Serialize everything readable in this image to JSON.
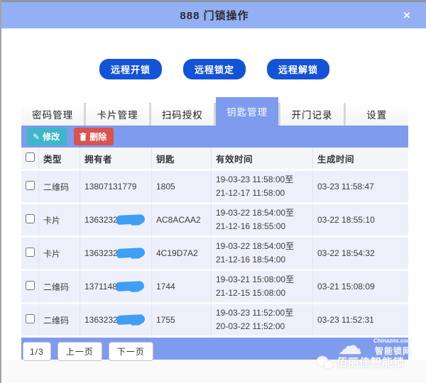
{
  "dialog": {
    "title": "888 门锁操作",
    "close_glyph": "×"
  },
  "actions": {
    "unlock_label": "远程开锁",
    "lock_label": "远程锁定",
    "release_label": "远程解锁"
  },
  "tabs": [
    {
      "label": "密码管理",
      "active": false
    },
    {
      "label": "卡片管理",
      "active": false
    },
    {
      "label": "扫码授权",
      "active": false
    },
    {
      "label": "钥匙管理",
      "active": true
    },
    {
      "label": "开门记录",
      "active": false
    },
    {
      "label": "设置",
      "active": false
    }
  ],
  "toolbar": {
    "modify_label": "修改",
    "modify_icon": "pencil-icon",
    "modify_glyph": "✎",
    "delete_label": "删除",
    "delete_icon": "trash-icon"
  },
  "table": {
    "columns": [
      "类型",
      "拥有者",
      "钥匙",
      "有效时间",
      "生成时间"
    ],
    "rows": [
      {
        "type": "二维码",
        "owner": "13807131779",
        "owner_redacted": false,
        "key": "1805",
        "valid_1": "19-03-23 11:58:00至",
        "valid_2": "21-12-17 11:58:00",
        "created": "03-23 11:58:47"
      },
      {
        "type": "卡片",
        "owner": "1363232",
        "owner_redacted": true,
        "key": "AC8ACAA2",
        "valid_1": "19-03-22 18:54:00至",
        "valid_2": "21-12-16 18:55:00",
        "created": "03-22 18:55:10"
      },
      {
        "type": "卡片",
        "owner": "1363232",
        "owner_redacted": true,
        "key": "4C19D7A2",
        "valid_1": "19-03-22 18:54:00至",
        "valid_2": "21-12-16 18:54:00",
        "created": "03-22 18:54:32"
      },
      {
        "type": "二维码",
        "owner": "1371148",
        "owner_redacted": true,
        "key": "1744",
        "valid_1": "19-03-21 15:08:00至",
        "valid_2": "21-12-15 15:08:00",
        "created": "03-21 15:08:09"
      },
      {
        "type": "二维码",
        "owner": "1363232",
        "owner_redacted": true,
        "key": "1755",
        "valid_1": "19-03-23 11:52:00至",
        "valid_2": "20-03-22 11:52:00",
        "created": "03-23 11:52:31"
      }
    ]
  },
  "pagination": {
    "page_indicator": "1/3",
    "prev_label": "上一页",
    "next_label": "下一页"
  },
  "watermark": {
    "site": "Chinazns.com",
    "brand": "智能锁网",
    "label": "佰丽佳智能锁"
  },
  "colors": {
    "titlebar": "#93b0f5",
    "accent_strip": "#7e9bee",
    "action_button": "#1553d6",
    "modify_button": "#3fb6c9",
    "delete_button": "#d9534f",
    "row_background": "#edf0fa",
    "redaction_scribble": "#3f9ef5"
  }
}
